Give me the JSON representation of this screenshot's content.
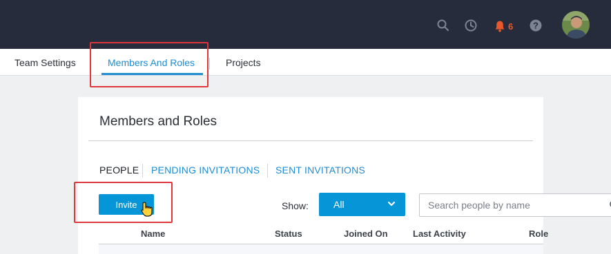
{
  "header": {
    "icons": [
      "search-icon",
      "clock-icon",
      "bell-icon",
      "help-icon"
    ],
    "notification_count": "6"
  },
  "tabs": {
    "team_settings": "Team Settings",
    "members_and_roles": "Members And Roles",
    "projects": "Projects",
    "active": "Members And Roles"
  },
  "card": {
    "title": "Members and Roles",
    "subtabs": {
      "people": "PEOPLE",
      "pending": "PENDING INVITATIONS",
      "sent": "SENT INVITATIONS"
    },
    "invite_label": "Invite",
    "show_label": "Show:",
    "show_value": "All",
    "search_placeholder": "Search people by name",
    "columns": {
      "name": "Name",
      "status": "Status",
      "joined": "Joined On",
      "last_activity": "Last Activity",
      "role": "Role"
    }
  },
  "colors": {
    "topbar": "#262c3c",
    "accent": "#0696d7",
    "link": "#1e8cd3",
    "notification": "#e8582a",
    "highlight": "#e0363b"
  }
}
